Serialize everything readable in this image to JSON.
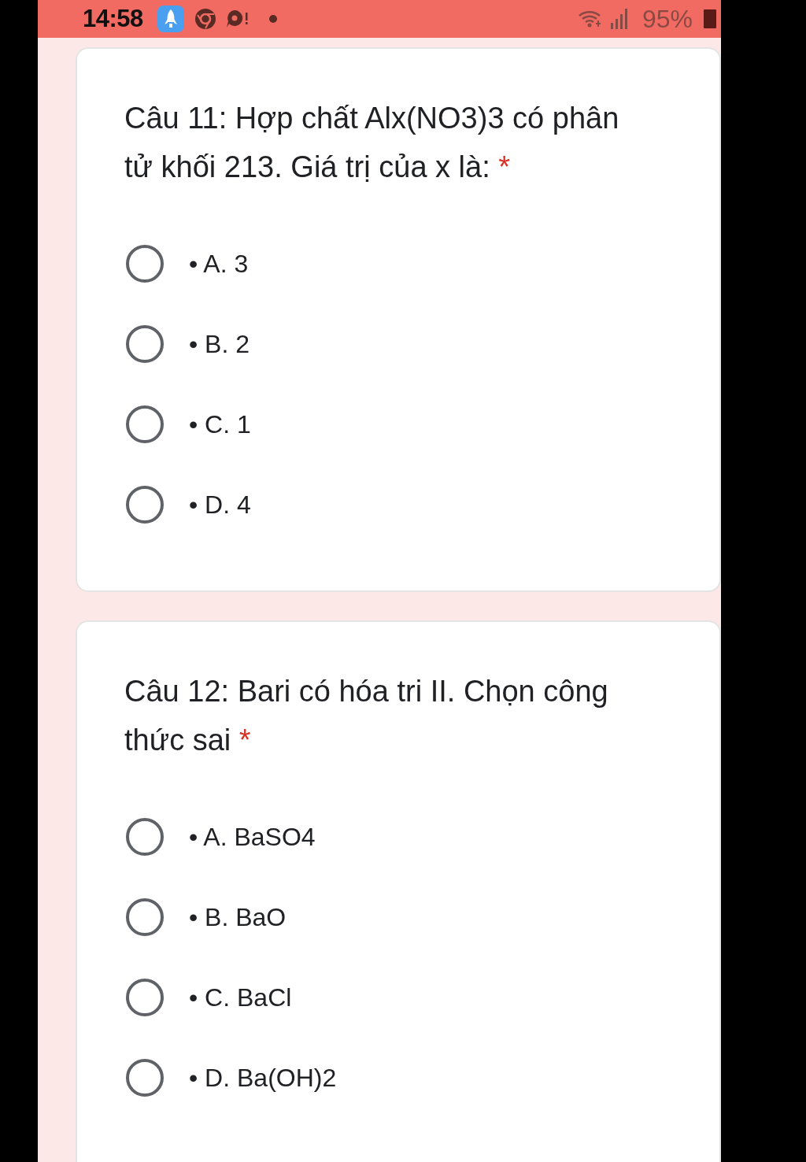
{
  "status_bar": {
    "time": "14:58",
    "battery": "95%"
  },
  "questions": [
    {
      "title": "Câu 11: Hợp chất Alx(NO3)3 có phân tử khối 213. Giá trị của x là:",
      "required_mark": "*",
      "options": [
        {
          "label": "• A. 3",
          "selected": false
        },
        {
          "label": "• B. 2",
          "selected": false
        },
        {
          "label": "• C. 1",
          "selected": false
        },
        {
          "label": "• D. 4",
          "selected": false
        }
      ]
    },
    {
      "title": "Câu 12: Bari có hóa tri II. Chọn công thức sai",
      "required_mark": "*",
      "options": [
        {
          "label": "• A. BaSO4",
          "selected": false
        },
        {
          "label": "• B. BaO",
          "selected": false
        },
        {
          "label": "• C. BaCl",
          "selected": false
        },
        {
          "label": "• D. Ba(OH)2",
          "selected": false
        }
      ]
    }
  ]
}
